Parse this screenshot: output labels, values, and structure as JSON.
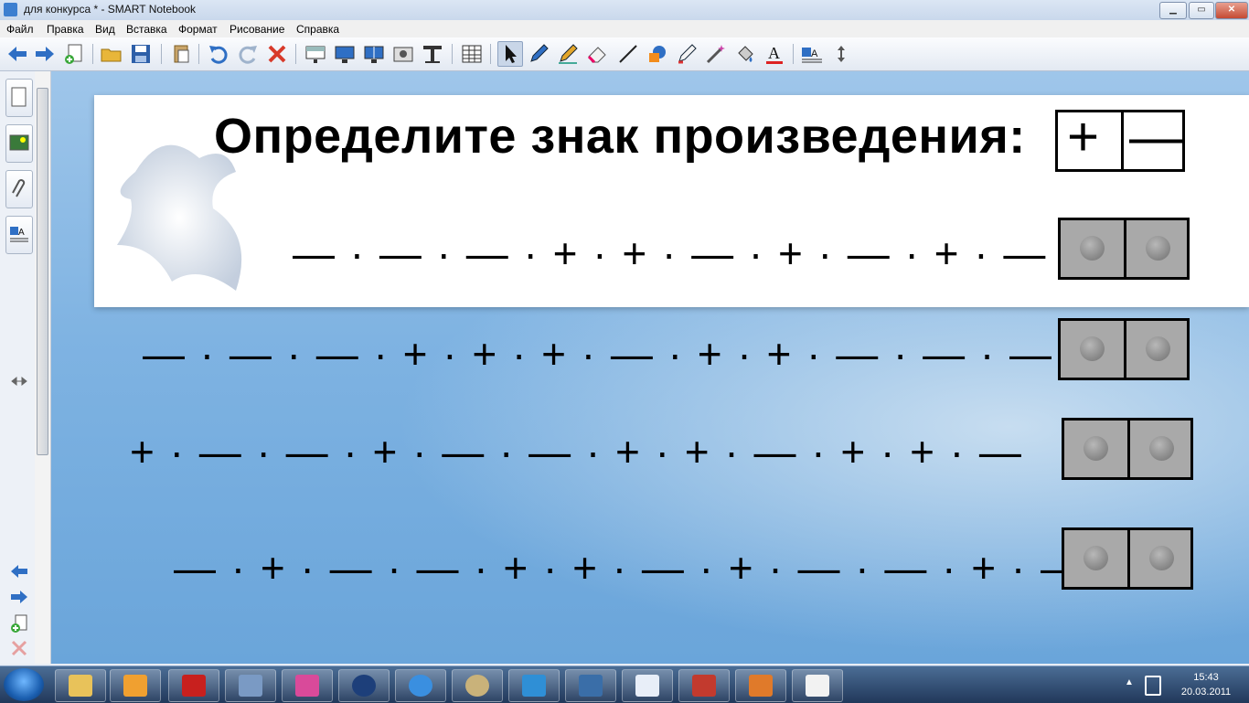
{
  "window": {
    "title": "для конкурса * - SMART Notebook",
    "min": "▁",
    "max": "▭",
    "close": "✕"
  },
  "menu": [
    "Файл",
    "Правка",
    "Вид",
    "Вставка",
    "Формат",
    "Рисование",
    "Справка"
  ],
  "toolbar_icons": [
    "back-arrow-icon",
    "forward-arrow-icon",
    "add-page-icon",
    "open-folder-icon",
    "save-icon",
    "paste-icon",
    "undo-icon",
    "redo-icon",
    "delete-icon",
    "screen-shade-icon",
    "full-screen-icon",
    "dual-view-icon",
    "capture-icon",
    "text-tool-icon",
    "table-icon",
    "select-icon",
    "pen-icon",
    "creative-pen-icon",
    "eraser-icon",
    "line-icon",
    "shapes-icon",
    "magic-pen-icon",
    "wand-icon",
    "fill-icon",
    "text-icon",
    "properties-icon",
    "move-toolbar-icon"
  ],
  "lesson": {
    "heading": "Определите знак произведения:",
    "legend_plus": "+",
    "legend_minus": "—",
    "rows": [
      "— · — · — · + · + · — · + · — · + · — · —",
      "— · — · — · + · + · + · — · + · + · — · — · —",
      "+ · — · — · + · — · — · + · + · — · + · + · —",
      "— · + · — · — · + · + · — · + · — · — · + · —"
    ]
  },
  "tray": {
    "time": "15:43",
    "date": "20.03.2011",
    "arrow": "▲"
  }
}
